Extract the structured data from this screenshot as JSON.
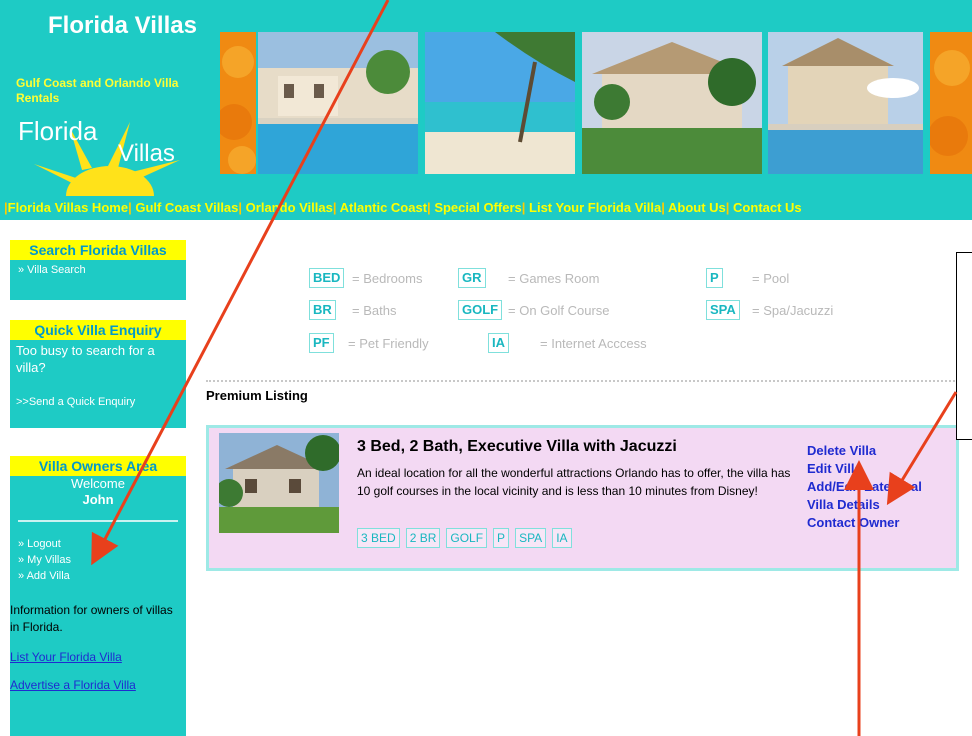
{
  "header": {
    "title": "Florida Villas",
    "subtitle": "Gulf Coast and Orlando Villa Rentals",
    "logo_word1": "Florida",
    "logo_word2": "Villas"
  },
  "nav": {
    "items": [
      "Florida Villas Home",
      "Gulf Coast Villas",
      "Orlando Villas",
      "Atlantic Coast",
      "Special Offers",
      "List Your Florida Villa",
      "About Us",
      "Contact Us"
    ]
  },
  "sidebar": {
    "search": {
      "title": "Search Florida Villas",
      "link": "» Villa Search"
    },
    "enquiry": {
      "title": "Quick Villa Enquiry",
      "text": "Too busy to search for a villa?",
      "link": ">>Send a Quick Enquiry"
    },
    "owners": {
      "title": "Villa Owners Area",
      "welcome": "Welcome",
      "user": "John",
      "links": [
        "» Logout",
        "» My Villas",
        "» Add Villa"
      ],
      "info": "Information for owners of villas in Florida.",
      "list_link": "List Your Florida Villa",
      "advertise_link": "Advertise a Florida Villa"
    }
  },
  "legend": {
    "items": [
      {
        "code": "BED",
        "label": "= Bedrooms"
      },
      {
        "code": "GR",
        "label": "= Games Room"
      },
      {
        "code": "P",
        "label": "= Pool"
      },
      {
        "code": "BR",
        "label": "= Baths"
      },
      {
        "code": "GOLF",
        "label": "= On Golf Course"
      },
      {
        "code": "SPA",
        "label": "= Spa/Jacuzzi"
      },
      {
        "code": "PF",
        "label": "= Pet Friendly"
      },
      {
        "code": "IA",
        "label": "= Internet Acccess"
      }
    ]
  },
  "section_label": "Premium Listing",
  "listing": {
    "title": "3 Bed, 2 Bath, Executive Villa with Jacuzzi",
    "description": "An ideal location for all the wonderful attractions Orlando has to offer, the villa has 10 golf courses in the local vicinity and is less than 10 minutes from Disney!",
    "tags": [
      "3 BED",
      "2 BR",
      "GOLF",
      "P",
      "SPA",
      "IA"
    ],
    "actions": [
      "Delete Villa",
      "Edit Villa",
      "Add/Edit Late Deal",
      "Villa Details",
      "Contact Owner"
    ]
  },
  "colors": {
    "brand": "#1ecbc5",
    "accent": "#ffff00",
    "annotation": "#e8401c",
    "listing_bg": "#f3d9f3"
  }
}
